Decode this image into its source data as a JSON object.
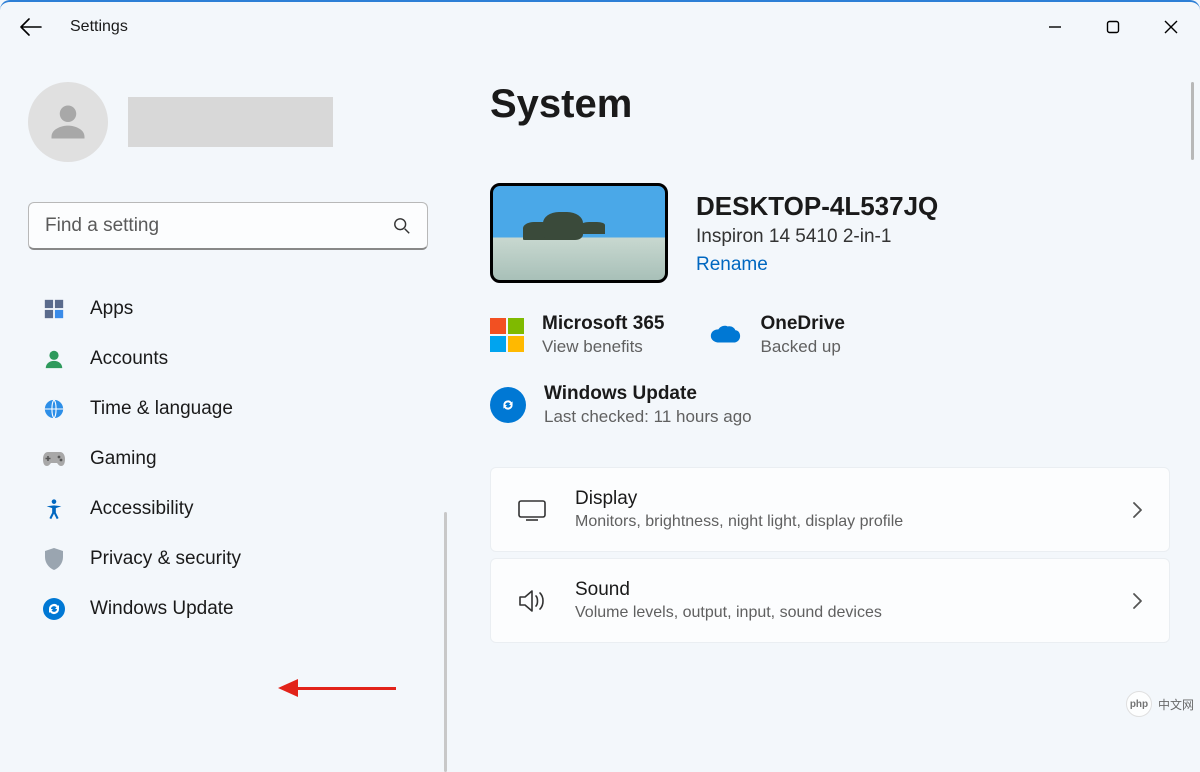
{
  "app_title": "Settings",
  "search": {
    "placeholder": "Find a setting"
  },
  "nav": {
    "apps": "Apps",
    "accounts": "Accounts",
    "time_language": "Time & language",
    "gaming": "Gaming",
    "accessibility": "Accessibility",
    "privacy_security": "Privacy & security",
    "windows_update": "Windows Update"
  },
  "page_title": "System",
  "device": {
    "name": "DESKTOP-4L537JQ",
    "model": "Inspiron 14 5410 2-in-1",
    "rename": "Rename"
  },
  "tiles": {
    "ms365": {
      "title": "Microsoft 365",
      "subtitle": "View benefits"
    },
    "onedrive": {
      "title": "OneDrive",
      "subtitle": "Backed up"
    }
  },
  "windows_update": {
    "title": "Windows Update",
    "subtitle": "Last checked: 11 hours ago"
  },
  "list": {
    "display": {
      "title": "Display",
      "subtitle": "Monitors, brightness, night light, display profile"
    },
    "sound": {
      "title": "Sound",
      "subtitle": "Volume levels, output, input, sound devices"
    }
  },
  "watermark": {
    "logo_label": "php",
    "text": "中文网"
  }
}
